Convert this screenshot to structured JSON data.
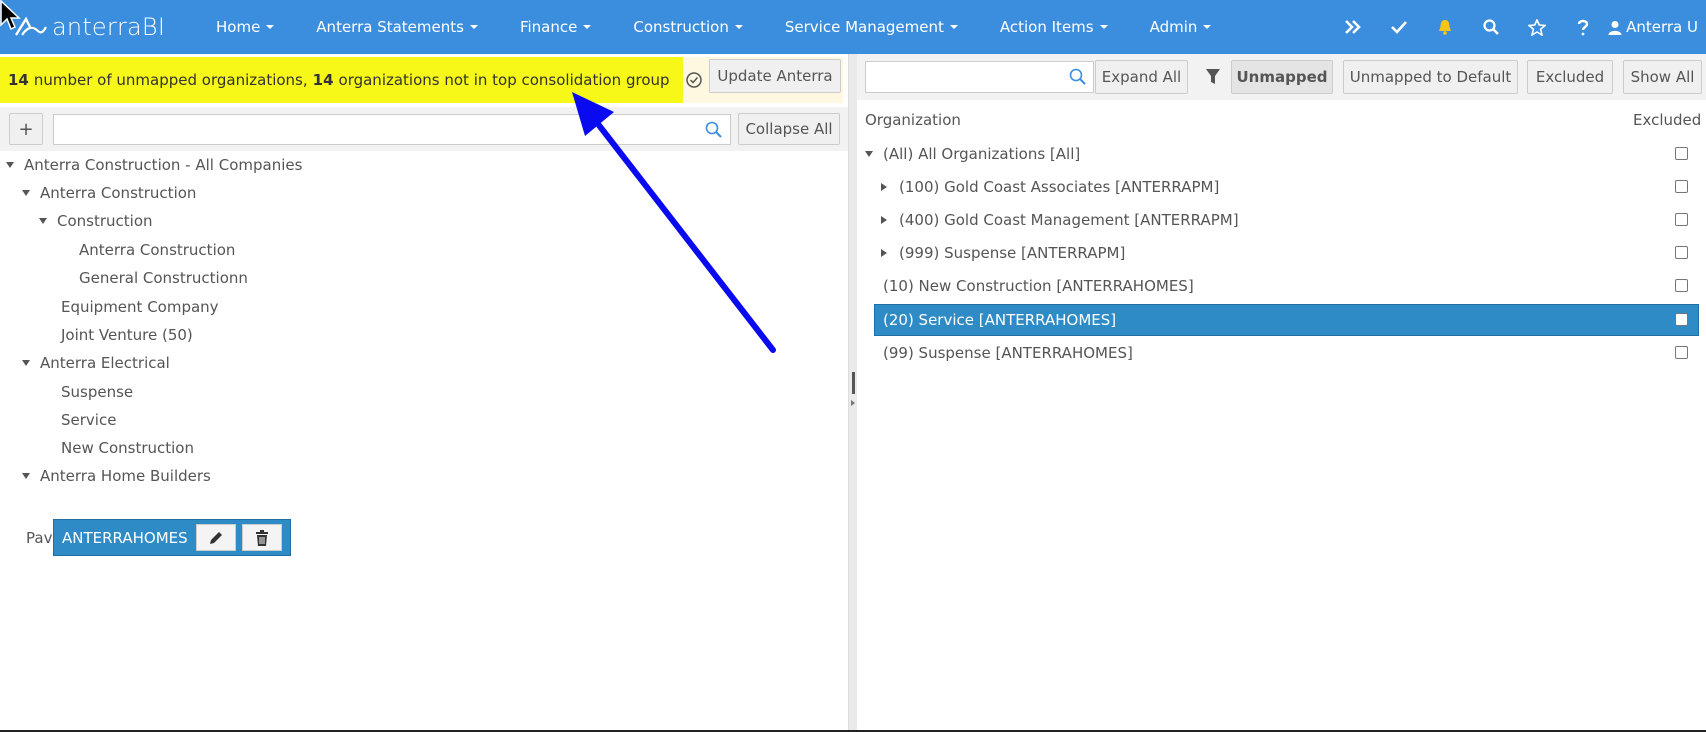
{
  "brand": {
    "name": "anterraBI"
  },
  "nav": {
    "items": [
      {
        "label": "Home"
      },
      {
        "label": "Anterra Statements"
      },
      {
        "label": "Finance"
      },
      {
        "label": "Construction"
      },
      {
        "label": "Service Management"
      },
      {
        "label": "Action Items"
      },
      {
        "label": "Admin"
      }
    ],
    "right_icons": [
      "double-chevron-right-icon",
      "check-icon",
      "bell-icon",
      "search-icon",
      "star-icon",
      "question-icon"
    ],
    "user_label": "Anterra U"
  },
  "alert": {
    "unmapped_count": "14",
    "unmapped_text": "number of unmapped organizations,",
    "not_in_group_count": "14",
    "not_in_group_text": "organizations not in top consolidation group",
    "update_button": "Update Anterra"
  },
  "left_toolbar": {
    "add_label": "+",
    "search_placeholder": "",
    "collapse_all": "Collapse All"
  },
  "tree": [
    {
      "label": "Anterra Construction - All Companies",
      "expanded": true
    },
    {
      "label": "Anterra Construction",
      "expanded": true
    },
    {
      "label": "Construction",
      "expanded": true
    },
    {
      "label": "Anterra Construction"
    },
    {
      "label": "General Constructionn"
    },
    {
      "label": "Equipment Company"
    },
    {
      "label": "Joint Venture (50)"
    },
    {
      "label": "Anterra Electrical",
      "expanded": true
    },
    {
      "label": "Suspense"
    },
    {
      "label": "Service"
    },
    {
      "label": "New Construction"
    },
    {
      "label": "Anterra Home Builders",
      "expanded": true
    },
    {
      "label": "ANTERRAHOMES",
      "selected": true
    },
    {
      "label": "Pavel Test"
    }
  ],
  "right_toolbar": {
    "search_placeholder": "",
    "expand_all": "Expand All",
    "unmapped": "Unmapped",
    "unmapped_to_default": "Unmapped to Default",
    "excluded": "Excluded",
    "show_all": "Show All"
  },
  "org_table": {
    "col_organization": "Organization",
    "col_excluded": "Excluded",
    "rows": [
      {
        "label": "(All) All Organizations [All]",
        "expanded": true,
        "excluded": false
      },
      {
        "label": "(100) Gold Coast Associates [ANTERRAPM]",
        "collapsed": true,
        "excluded": false
      },
      {
        "label": "(400) Gold Coast Management [ANTERRAPM]",
        "collapsed": true,
        "excluded": false
      },
      {
        "label": "(999) Suspense [ANTERRAPM]",
        "collapsed": true,
        "excluded": false
      },
      {
        "label": "(10) New Construction [ANTERRAHOMES]",
        "excluded": false
      },
      {
        "label": "(20) Service [ANTERRAHOMES]",
        "selected": true,
        "excluded": false
      },
      {
        "label": "(99) Suspense [ANTERRAHOMES]",
        "excluded": false
      }
    ]
  },
  "colors": {
    "navbar": "#3b8ede",
    "alert_highlight": "#f7f718",
    "selected": "#2e8bc6",
    "annotation_arrow": "#0a0af0",
    "bell": "#f5c518"
  }
}
